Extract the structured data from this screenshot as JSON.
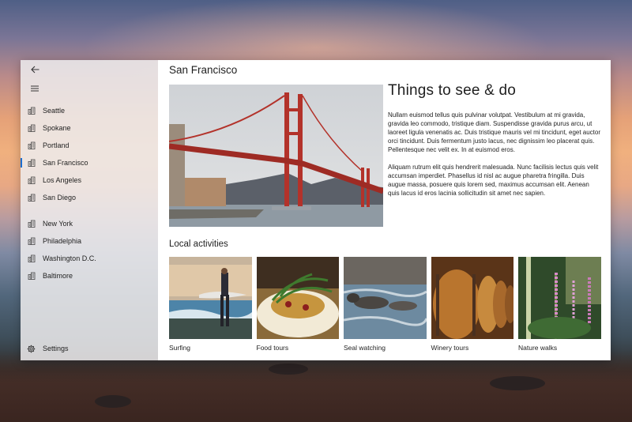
{
  "app": {
    "page_title": "San Francisco"
  },
  "nav": {
    "back_icon": "back-arrow-icon",
    "menu_icon": "hamburger-icon",
    "item_icon": "city-buildings-icon",
    "group1": [
      {
        "label": "Seattle",
        "selected": false
      },
      {
        "label": "Spokane",
        "selected": false
      },
      {
        "label": "Portland",
        "selected": false
      },
      {
        "label": "San Francisco",
        "selected": true
      },
      {
        "label": "Los Angeles",
        "selected": false
      },
      {
        "label": "San Diego",
        "selected": false
      }
    ],
    "group2": [
      {
        "label": "New York",
        "selected": false
      },
      {
        "label": "Philadelphia",
        "selected": false
      },
      {
        "label": "Washington D.C.",
        "selected": false
      },
      {
        "label": "Baltimore",
        "selected": false
      }
    ],
    "settings": {
      "label": "Settings",
      "icon": "gear-icon"
    }
  },
  "article": {
    "title": "Things to see & do",
    "paragraph1": "Nullam euismod tellus quis pulvinar volutpat. Vestibulum at mi gravida, gravida leo commodo, tristique diam. Suspendisse gravida purus arcu, ut laoreet ligula venenatis ac. Duis tristique mauris vel mi tincidunt, eget auctor orci tincidunt. Duis fermentum justo lacus, nec dignissim leo placerat quis. Pellentesque nec velit ex. In at euismod eros.",
    "paragraph2": "Aliquam rutrum elit quis hendrerit malesuada. Nunc facilisis lectus quis velit accumsan imperdiet. Phasellus id nisl ac augue pharetra fringilla. Duis augue massa, posuere quis lorem sed, maximus accumsan elit. Aenean quis lacus id eros lacinia sollicitudin sit amet nec sapien."
  },
  "activities": {
    "heading": "Local activities",
    "items": [
      {
        "label": "Surfing"
      },
      {
        "label": "Food tours"
      },
      {
        "label": "Seal watching"
      },
      {
        "label": "Winery tours"
      },
      {
        "label": "Nature walks"
      }
    ]
  },
  "colors": {
    "accent": "#1b6ed1",
    "nav_background": "#eeeced",
    "content_background": "#ffffff",
    "bridge_red": "#b3322a"
  }
}
